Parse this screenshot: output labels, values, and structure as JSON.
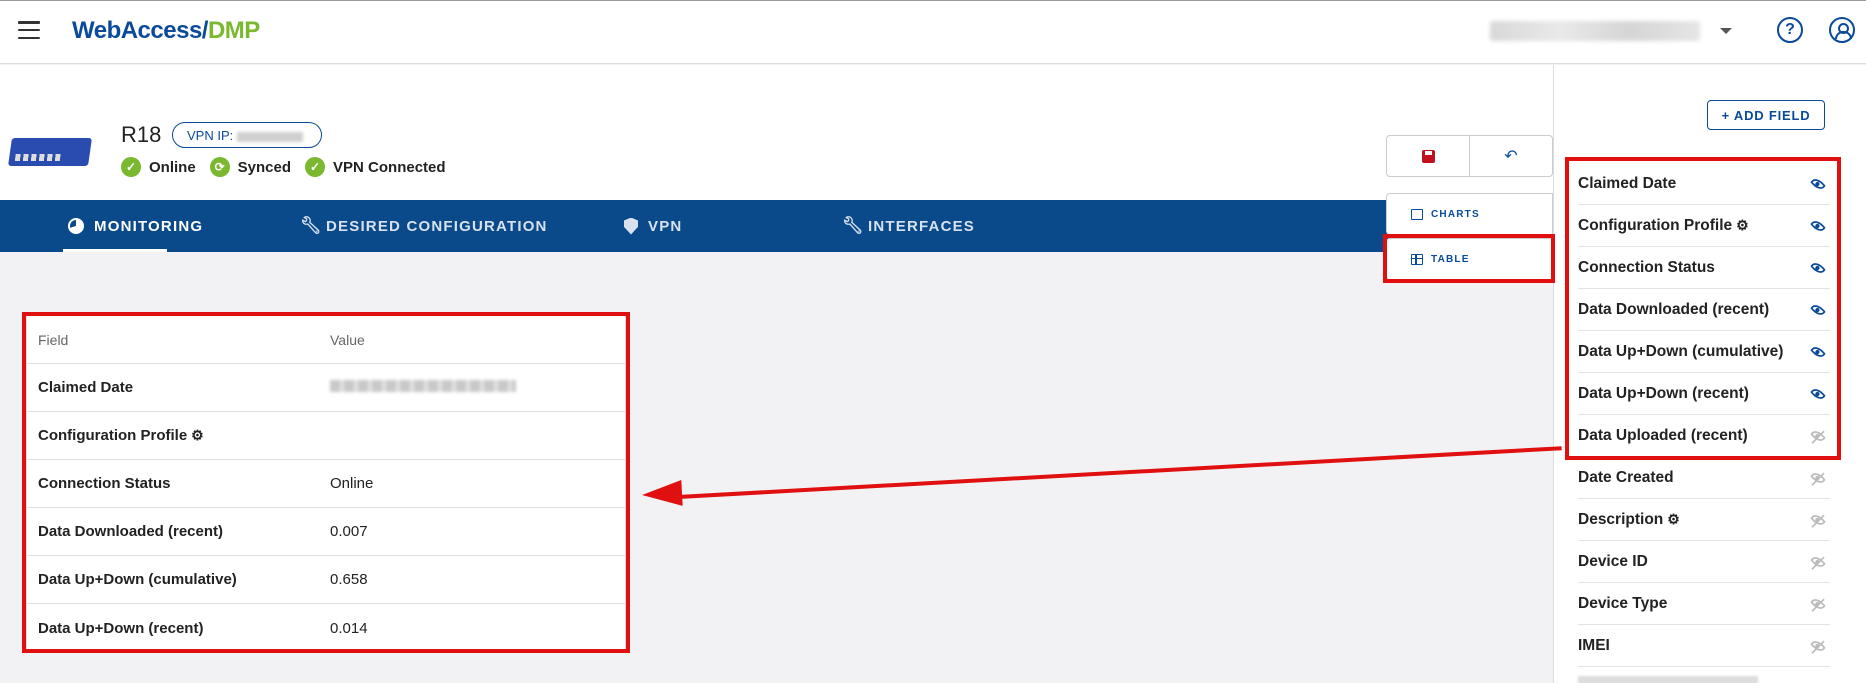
{
  "app": {
    "logo_part1": "WebAccess/",
    "logo_part2": "DMP"
  },
  "header": {
    "help_icon": "?",
    "menu_icon": "hamburger-icon",
    "user_icon": "user-circle-icon"
  },
  "device": {
    "name": "R18",
    "vpn_label": "VPN IP:",
    "statuses": [
      {
        "label": "Online",
        "icon": "check-circle-icon"
      },
      {
        "label": "Synced",
        "icon": "sync-icon"
      },
      {
        "label": "VPN Connected",
        "icon": "check-circle-icon"
      }
    ]
  },
  "tabs": [
    {
      "label": "MONITORING",
      "icon": "pie-chart-icon",
      "active": true
    },
    {
      "label": "DESIRED CONFIGURATION",
      "icon": "wrench-icon"
    },
    {
      "label": "VPN",
      "icon": "shield-icon"
    },
    {
      "label": "INTERFACES",
      "icon": "wrench-icon"
    }
  ],
  "toolbar": {
    "save_icon": "save-icon",
    "undo_icon": "undo-icon",
    "undo_glyph": "↶"
  },
  "side_tabs": {
    "charts": "CHARTS",
    "table": "TABLE"
  },
  "table": {
    "headers": [
      "Field",
      "Value"
    ],
    "rows": [
      {
        "field": "Claimed Date",
        "value": ""
      },
      {
        "field": "Configuration Profile",
        "value": ""
      },
      {
        "field": "Connection Status",
        "value": "Online"
      },
      {
        "field": "Data Downloaded (recent)",
        "value": "0.007"
      },
      {
        "field": "Data Up+Down (cumulative)",
        "value": "0.658"
      },
      {
        "field": "Data Up+Down (recent)",
        "value": "0.014"
      }
    ]
  },
  "right_panel": {
    "add_field_label": "+ ADD FIELD",
    "fields": [
      {
        "label": "Claimed Date",
        "visible": true
      },
      {
        "label": "Configuration Profile",
        "visible": true
      },
      {
        "label": "Connection Status",
        "visible": true
      },
      {
        "label": "Data Downloaded (recent)",
        "visible": true
      },
      {
        "label": "Data Up+Down (cumulative)",
        "visible": true
      },
      {
        "label": "Data Up+Down (recent)",
        "visible": true
      },
      {
        "label": "Data Uploaded (recent)",
        "visible": false
      },
      {
        "label": "Date Created",
        "visible": false
      },
      {
        "label": "Description",
        "visible": false
      },
      {
        "label": "Device ID",
        "visible": false
      },
      {
        "label": "Device Type",
        "visible": false
      },
      {
        "label": "IMEI",
        "visible": false
      }
    ]
  },
  "colors": {
    "brand_blue": "#0a4a8a",
    "brand_green": "#7ab92f",
    "annotation_red": "#e01010"
  }
}
